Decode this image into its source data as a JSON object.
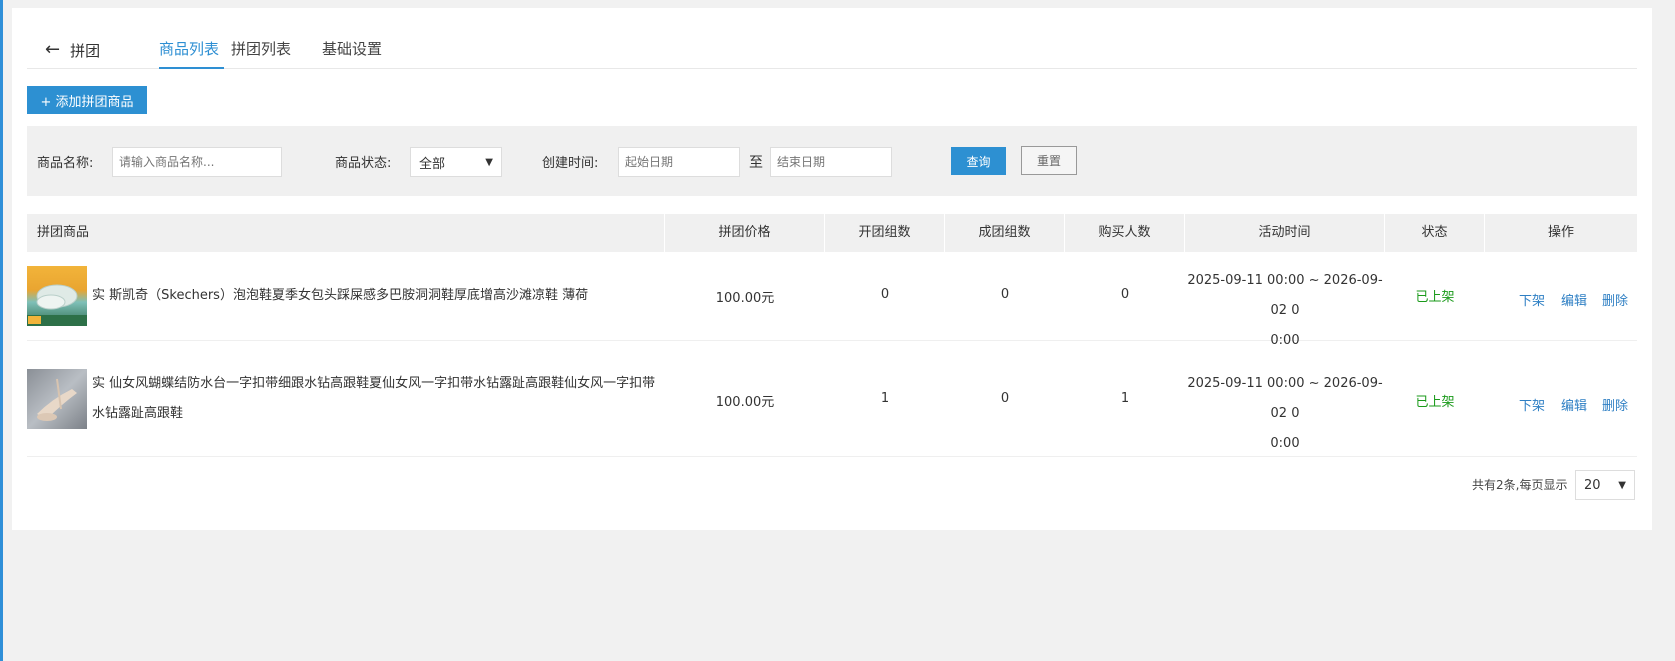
{
  "header": {
    "back_label": "拼团",
    "tabs": [
      {
        "label": "商品列表",
        "active": true
      },
      {
        "label": "拼团列表",
        "active": false
      },
      {
        "label": "基础设置",
        "active": false
      }
    ]
  },
  "toolbar": {
    "add_label": "+ 添加拼团商品"
  },
  "filter": {
    "name_label": "商品名称:",
    "name_placeholder": "请输入商品名称...",
    "status_label": "商品状态:",
    "status_value": "全部",
    "time_label": "创建时间:",
    "start_placeholder": "起始日期",
    "to_label": "至",
    "end_placeholder": "结束日期",
    "query_label": "查询",
    "reset_label": "重置"
  },
  "table": {
    "headers": [
      "拼团商品",
      "拼团价格",
      "开团组数",
      "成团组数",
      "购买人数",
      "活动时间",
      "状态",
      "操作"
    ],
    "rows": [
      {
        "name": "实 斯凯奇（Skechers）泡泡鞋夏季女包头踩屎感多巴胺洞洞鞋厚底增高沙滩凉鞋 薄荷",
        "price": "100.00元",
        "open": "0",
        "formed": "0",
        "buyers": "0",
        "time_line1": "2025-09-11 00:00 ~ 2026-09-02 0",
        "time_line2": "0:00",
        "status": "已上架",
        "op_off": "下架",
        "op_edit": "编辑",
        "op_delete": "删除"
      },
      {
        "name_line1": "实 仙女风蝴蝶结防水台一字扣带细跟水钻高跟鞋夏仙女风一字扣带水钻露趾高跟鞋仙女风一字扣带",
        "name_line2": "水钻露趾高跟鞋",
        "price": "100.00元",
        "open": "1",
        "formed": "0",
        "buyers": "1",
        "time_line1": "2025-09-11 00:00 ~ 2026-09-02 0",
        "time_line2": "0:00",
        "status": "已上架",
        "op_off": "下架",
        "op_edit": "编辑",
        "op_delete": "删除"
      }
    ]
  },
  "pager": {
    "summary": "共有2条,每页显示",
    "page_size": "20"
  },
  "colors": {
    "accent": "#2d90d2",
    "status_on": "#1a9a1a",
    "link": "#2e7fc4"
  },
  "icons": [
    "back-arrow-icon",
    "chevron-down-icon"
  ]
}
